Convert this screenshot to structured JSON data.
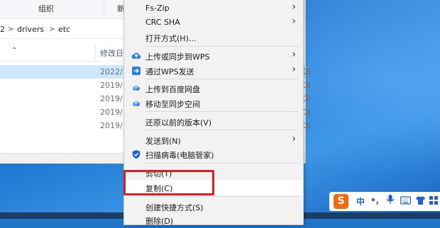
{
  "explorer": {
    "ribbon": {
      "tab_organize": "组织",
      "tab_new_partial": "新"
    },
    "address": {
      "prefix": "2",
      "crumbs": [
        "drivers",
        "etc"
      ],
      "separator": ">"
    },
    "column_header": {
      "modified_label": "修改日"
    },
    "rows": [
      {
        "date": "2022/3",
        "size": "KB"
      },
      {
        "date": "2019/1",
        "size": "KB"
      },
      {
        "date": "2019/1",
        "size": "KB"
      },
      {
        "date": "2019/1",
        "size": "KB"
      },
      {
        "date": "2019/1",
        "size": "KB"
      }
    ]
  },
  "context_menu": {
    "items": [
      {
        "label": "Fs-Zip",
        "submenu": true
      },
      {
        "label": "CRC SHA",
        "submenu": true
      },
      {
        "label": "打开方式(H)..."
      },
      {
        "label": "上传或同步到WPS",
        "submenu": true,
        "icon": "wps-cloud-upload-icon"
      },
      {
        "label": "通过WPS发送",
        "submenu": true,
        "icon": "wps-send-icon"
      },
      {
        "label": "上传到百度网盘",
        "icon": "baidu-netdisk-icon"
      },
      {
        "label": "移动至同步空间",
        "icon": "sync-space-icon"
      },
      {
        "label": "还原以前的版本(V)"
      },
      {
        "label": "发送到(N)",
        "submenu": true
      },
      {
        "label": "扫描病毒(电脑管家)",
        "icon": "pc-manager-shield-icon"
      },
      {
        "label": "剪切(T)"
      },
      {
        "label": "复制(C)"
      },
      {
        "label": "创建快捷方式(S)"
      },
      {
        "label": "删除(D)"
      }
    ],
    "highlighted_item": "复制(C)"
  },
  "ime_toolbar": {
    "logo": "S",
    "mode": "中",
    "punct": "•,",
    "icons": [
      "microphone-icon",
      "keyboard-icon",
      "shirt-skin-icon",
      "grid-toolbox-icon"
    ]
  },
  "colors": {
    "highlight_box": "#d9201f",
    "selection": "#cce8ff",
    "menu_bg": "#f2f2f2",
    "ime_logo": "#f06a0f"
  }
}
